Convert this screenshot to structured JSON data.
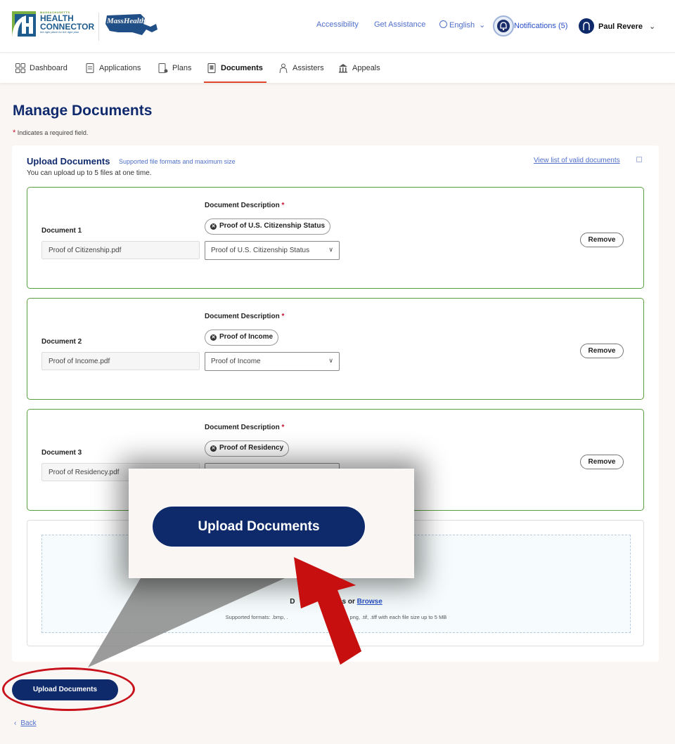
{
  "header": {
    "logo_primary": {
      "small": "MASSACHUSETTS",
      "line1": "HEALTH",
      "line2": "CONNECTOR",
      "tagline": "the right place for the right plan"
    },
    "logo_secondary": "MassHealth",
    "links": {
      "accessibility": "Accessibility",
      "get_assistance": "Get Assistance",
      "language": "English",
      "notifications": "Notifications (5)",
      "user": "Paul Revere"
    }
  },
  "nav": {
    "items": [
      {
        "label": "Dashboard",
        "icon": "dashboard-icon"
      },
      {
        "label": "Applications",
        "icon": "applications-icon"
      },
      {
        "label": "Plans",
        "icon": "plans-icon"
      },
      {
        "label": "Documents",
        "icon": "documents-icon",
        "active": true
      },
      {
        "label": "Assisters",
        "icon": "assisters-icon"
      },
      {
        "label": "Appeals",
        "icon": "appeals-icon"
      }
    ]
  },
  "page": {
    "title": "Manage Documents",
    "required_star": "*",
    "required_note": "Indicates a required field."
  },
  "upload_card": {
    "title": "Upload Documents",
    "subtitle": "Supported file formats and maximum size",
    "note": "You can upload up to 5 files at one time.",
    "valid_docs_link": "View list of valid documents",
    "description_label": "Document Description",
    "remove_label": "Remove",
    "documents": [
      {
        "label": "Document 1",
        "file": "Proof of Citizenship.pdf",
        "chip": "Proof of U.S. Citizenship Status",
        "selected": "Proof of U.S. Citizenship Status"
      },
      {
        "label": "Document 2",
        "file": "Proof of Income.pdf",
        "chip": "Proof of Income",
        "selected": "Proof of Income"
      },
      {
        "label": "Document 3",
        "file": "Proof of Residency.pdf",
        "chip": "Proof of Residency",
        "selected": ""
      }
    ],
    "dropzone": {
      "text_visible_prefix": "D",
      "text_visible_mid": "iles or",
      "browse": "Browse",
      "formats": "Supported formats: .bmp, .",
      "formats_tail": "png, .tif, .tiff with each file size up to 5 MB"
    }
  },
  "actions": {
    "upload_button": "Upload Documents",
    "back": "Back"
  },
  "annotation": {
    "zoom_label": "Upload Documents",
    "highlight_color": "#c8111a"
  },
  "colors": {
    "brand_navy": "#0f2a6b",
    "link": "#4f6fc9",
    "active_tab": "#e0452a",
    "doc_border": "#5a9e3e",
    "required": "#c8102e"
  }
}
